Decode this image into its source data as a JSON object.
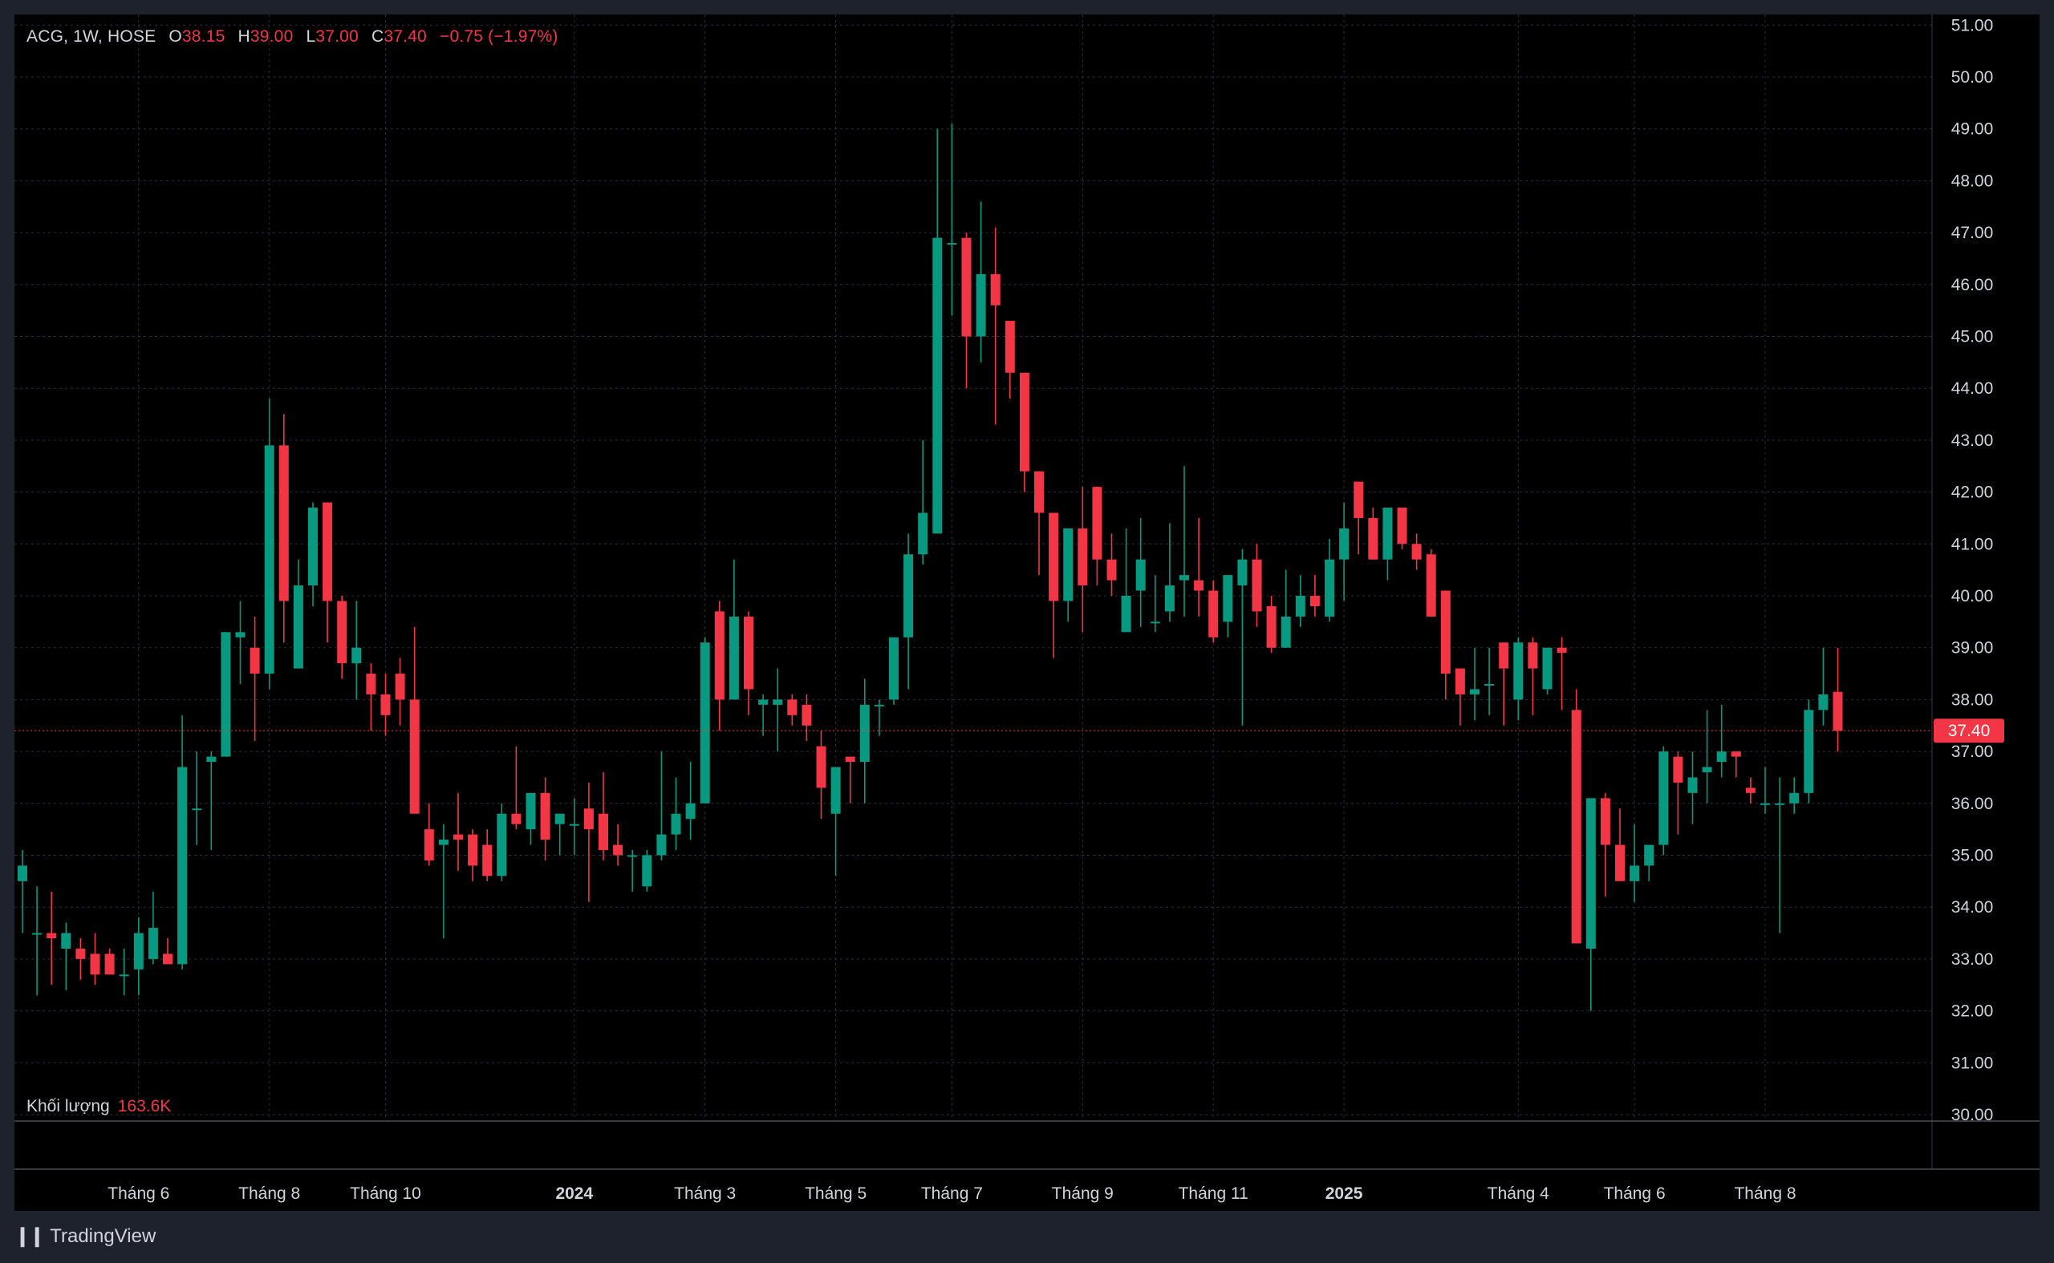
{
  "header": {
    "symbol": "ACG, 1W, HOSE",
    "open_label": "O",
    "open": "38.15",
    "high_label": "H",
    "high": "39.00",
    "low_label": "L",
    "low": "37.00",
    "close_label": "C",
    "close": "37.40",
    "change": "−0.75 (−1.97%)"
  },
  "volume_legend": {
    "label": "Khối lượng",
    "value": "163.6K"
  },
  "branding": {
    "name": "TradingView"
  },
  "colors": {
    "up": "#089981",
    "down": "#f23645",
    "background": "#000000",
    "grid": "#2a2e39",
    "text": "#d1d4dc",
    "price_line": "#f23645"
  },
  "chart_data": {
    "type": "candlestick",
    "symbol": "ACG",
    "interval": "1W",
    "exchange": "HOSE",
    "last_price": 37.4,
    "last_price_label": "37.40",
    "y_range": [
      30,
      51
    ],
    "y_ticks": [
      "51.00",
      "50.00",
      "49.00",
      "48.00",
      "47.00",
      "46.00",
      "45.00",
      "44.00",
      "43.00",
      "42.00",
      "41.00",
      "40.00",
      "39.00",
      "38.00",
      "37.00",
      "36.00",
      "35.00",
      "34.00",
      "33.00",
      "32.00",
      "31.00",
      "30.00"
    ],
    "x_ticks": [
      {
        "label": "Tháng 6",
        "index": 8,
        "bold": false
      },
      {
        "label": "Tháng 8",
        "index": 17,
        "bold": false
      },
      {
        "label": "Tháng 10",
        "index": 25,
        "bold": false
      },
      {
        "label": "2024",
        "index": 38,
        "bold": true
      },
      {
        "label": "Tháng 3",
        "index": 47,
        "bold": false
      },
      {
        "label": "Tháng 5",
        "index": 56,
        "bold": false
      },
      {
        "label": "Tháng 7",
        "index": 64,
        "bold": false
      },
      {
        "label": "Tháng 9",
        "index": 73,
        "bold": false
      },
      {
        "label": "Tháng 11",
        "index": 82,
        "bold": false
      },
      {
        "label": "2025",
        "index": 91,
        "bold": true
      },
      {
        "label": "Tháng 4",
        "index": 103,
        "bold": false
      },
      {
        "label": "Tháng 6",
        "index": 111,
        "bold": false
      },
      {
        "label": "Tháng 8",
        "index": 120,
        "bold": false
      }
    ],
    "ohlc": [
      [
        34.5,
        35.1,
        33.5,
        34.8
      ],
      [
        33.5,
        34.4,
        32.3,
        33.5
      ],
      [
        33.5,
        34.3,
        32.5,
        33.4
      ],
      [
        33.2,
        33.7,
        32.4,
        33.5
      ],
      [
        33.2,
        33.4,
        32.6,
        33.0
      ],
      [
        33.1,
        33.5,
        32.5,
        32.7
      ],
      [
        33.1,
        33.2,
        32.7,
        32.7
      ],
      [
        32.7,
        33.2,
        32.3,
        32.7
      ],
      [
        32.8,
        33.8,
        32.3,
        33.5
      ],
      [
        33.0,
        34.3,
        32.9,
        33.6
      ],
      [
        33.1,
        33.4,
        32.9,
        32.9
      ],
      [
        32.9,
        37.7,
        32.8,
        36.7
      ],
      [
        35.9,
        37.0,
        35.2,
        35.9
      ],
      [
        36.8,
        37.0,
        35.1,
        36.9
      ],
      [
        36.9,
        39.3,
        36.9,
        39.3
      ],
      [
        39.2,
        39.9,
        38.3,
        39.3
      ],
      [
        39.0,
        39.6,
        37.2,
        38.5
      ],
      [
        38.5,
        43.8,
        38.2,
        42.9
      ],
      [
        42.9,
        43.5,
        39.1,
        39.9
      ],
      [
        38.6,
        40.7,
        38.6,
        40.2
      ],
      [
        40.2,
        41.8,
        39.8,
        41.7
      ],
      [
        41.8,
        41.8,
        39.1,
        39.9
      ],
      [
        39.9,
        40.0,
        38.4,
        38.7
      ],
      [
        38.7,
        39.9,
        38.0,
        39.0
      ],
      [
        38.5,
        38.7,
        37.4,
        38.1
      ],
      [
        38.1,
        38.5,
        37.3,
        37.7
      ],
      [
        38.5,
        38.8,
        37.5,
        38.0
      ],
      [
        38.0,
        39.4,
        37.5,
        35.8
      ],
      [
        35.5,
        36.0,
        34.8,
        34.9
      ],
      [
        35.2,
        35.6,
        33.4,
        35.3
      ],
      [
        35.4,
        36.2,
        34.7,
        35.3
      ],
      [
        35.4,
        35.5,
        34.5,
        34.8
      ],
      [
        35.2,
        35.5,
        34.5,
        34.6
      ],
      [
        34.6,
        36.0,
        34.5,
        35.8
      ],
      [
        35.8,
        37.1,
        35.5,
        35.6
      ],
      [
        35.5,
        36.0,
        35.2,
        36.2
      ],
      [
        36.2,
        36.5,
        34.9,
        35.3
      ],
      [
        35.6,
        35.8,
        35.0,
        35.8
      ],
      [
        35.6,
        36.1,
        35.0,
        35.6
      ],
      [
        35.9,
        36.4,
        34.1,
        35.5
      ],
      [
        35.8,
        36.6,
        34.9,
        35.1
      ],
      [
        35.2,
        35.6,
        34.8,
        35.0
      ],
      [
        35.0,
        35.1,
        34.3,
        35.0
      ],
      [
        34.4,
        35.1,
        34.3,
        35.0
      ],
      [
        35.0,
        37.0,
        34.9,
        35.4
      ],
      [
        35.4,
        36.5,
        35.1,
        35.8
      ],
      [
        35.7,
        36.8,
        35.3,
        36.0
      ],
      [
        36.0,
        39.2,
        36.0,
        39.1
      ],
      [
        39.7,
        39.9,
        37.4,
        38.0
      ],
      [
        38.0,
        40.7,
        38.0,
        39.6
      ],
      [
        39.6,
        39.7,
        37.7,
        38.2
      ],
      [
        37.9,
        38.1,
        37.3,
        38.0
      ],
      [
        37.9,
        38.6,
        37.0,
        38.0
      ],
      [
        38.0,
        38.1,
        37.5,
        37.7
      ],
      [
        37.9,
        38.1,
        37.2,
        37.5
      ],
      [
        37.1,
        37.4,
        35.7,
        36.3
      ],
      [
        35.8,
        36.7,
        34.6,
        36.7
      ],
      [
        36.9,
        36.9,
        36.0,
        36.8
      ],
      [
        36.8,
        38.4,
        36.0,
        37.9
      ],
      [
        37.9,
        38.0,
        37.3,
        37.9
      ],
      [
        38.0,
        38.2,
        37.9,
        39.2
      ],
      [
        39.2,
        41.2,
        38.2,
        40.8
      ],
      [
        40.8,
        43.0,
        40.6,
        41.6
      ],
      [
        41.2,
        49.0,
        41.2,
        46.9
      ],
      [
        46.8,
        49.1,
        45.4,
        46.8
      ],
      [
        46.9,
        47.0,
        44.0,
        45.0
      ],
      [
        45.0,
        47.6,
        44.5,
        46.2
      ],
      [
        46.2,
        47.1,
        43.3,
        45.6
      ],
      [
        45.3,
        45.3,
        43.8,
        44.3
      ],
      [
        44.3,
        44.3,
        42.0,
        42.4
      ],
      [
        42.4,
        42.4,
        40.4,
        41.6
      ],
      [
        41.6,
        41.6,
        38.8,
        39.9
      ],
      [
        39.9,
        41.2,
        39.5,
        41.3
      ],
      [
        41.3,
        42.1,
        39.3,
        40.2
      ],
      [
        42.1,
        42.1,
        40.2,
        40.7
      ],
      [
        40.7,
        41.2,
        40.0,
        40.3
      ],
      [
        39.3,
        41.3,
        39.3,
        40.0
      ],
      [
        40.1,
        41.5,
        39.4,
        40.7
      ],
      [
        39.5,
        40.4,
        39.3,
        39.5
      ],
      [
        39.7,
        41.4,
        39.5,
        40.2
      ],
      [
        40.3,
        42.5,
        39.6,
        40.4
      ],
      [
        40.3,
        41.5,
        39.6,
        40.1
      ],
      [
        40.1,
        40.3,
        39.1,
        39.2
      ],
      [
        39.5,
        40.3,
        39.2,
        40.4
      ],
      [
        40.2,
        40.9,
        37.5,
        40.7
      ],
      [
        40.7,
        41.0,
        39.4,
        39.7
      ],
      [
        39.8,
        40.0,
        38.9,
        39.0
      ],
      [
        39.0,
        40.5,
        39.0,
        39.6
      ],
      [
        39.6,
        40.4,
        39.4,
        40.0
      ],
      [
        40.0,
        40.4,
        39.6,
        39.8
      ],
      [
        39.6,
        41.1,
        39.5,
        40.7
      ],
      [
        40.7,
        41.8,
        39.9,
        41.3
      ],
      [
        42.2,
        42.2,
        40.8,
        41.5
      ],
      [
        41.5,
        41.7,
        40.7,
        40.7
      ],
      [
        40.7,
        41.5,
        40.3,
        41.7
      ],
      [
        41.7,
        41.7,
        40.9,
        41.0
      ],
      [
        41.0,
        41.2,
        40.5,
        40.7
      ],
      [
        40.8,
        40.9,
        39.6,
        39.6
      ],
      [
        40.1,
        40.1,
        38.0,
        38.5
      ],
      [
        38.6,
        38.6,
        37.5,
        38.1
      ],
      [
        38.1,
        39.0,
        37.6,
        38.2
      ],
      [
        38.3,
        39.0,
        37.7,
        38.3
      ],
      [
        39.1,
        39.1,
        37.5,
        38.6
      ],
      [
        38.0,
        39.2,
        37.6,
        39.1
      ],
      [
        39.1,
        39.2,
        37.7,
        38.6
      ],
      [
        38.2,
        39.0,
        38.1,
        39.0
      ],
      [
        39.0,
        39.2,
        37.8,
        38.9
      ],
      [
        37.8,
        38.2,
        33.5,
        33.3
      ],
      [
        33.2,
        36.1,
        32.0,
        36.1
      ],
      [
        36.1,
        36.2,
        34.2,
        35.2
      ],
      [
        35.2,
        35.9,
        34.5,
        34.5
      ],
      [
        34.5,
        35.6,
        34.1,
        34.8
      ],
      [
        34.8,
        35.1,
        34.5,
        35.2
      ],
      [
        35.2,
        37.1,
        35.0,
        37.0
      ],
      [
        36.9,
        37.0,
        35.4,
        36.4
      ],
      [
        36.2,
        37.0,
        35.6,
        36.5
      ],
      [
        36.6,
        37.8,
        36.0,
        36.7
      ],
      [
        36.8,
        37.9,
        36.5,
        37.0
      ],
      [
        37.0,
        37.0,
        36.5,
        36.9
      ],
      [
        36.3,
        36.5,
        36.0,
        36.2
      ],
      [
        36.0,
        36.7,
        35.8,
        36.0
      ],
      [
        36.0,
        36.5,
        33.5,
        36.0
      ],
      [
        36.0,
        36.5,
        35.8,
        36.2
      ],
      [
        36.2,
        38.0,
        36.0,
        37.8
      ],
      [
        37.8,
        39.0,
        37.5,
        38.1
      ],
      [
        38.15,
        39.0,
        37.0,
        37.4
      ]
    ]
  }
}
